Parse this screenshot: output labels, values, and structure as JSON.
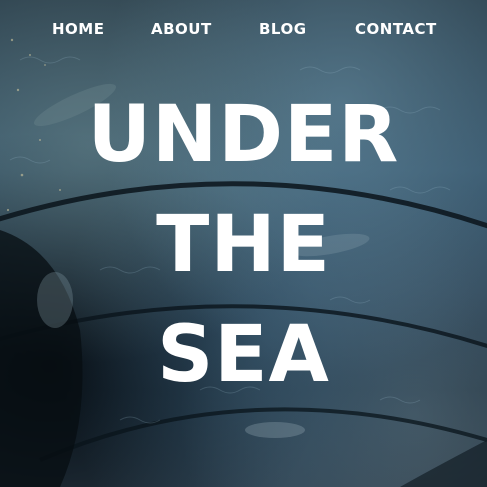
{
  "nav": {
    "items": [
      {
        "label": "HOME"
      },
      {
        "label": "ABOUT"
      },
      {
        "label": "BLOG"
      },
      {
        "label": "CONTACT"
      }
    ]
  },
  "hero": {
    "title_lines": [
      "UNDER",
      "THE",
      "SEA"
    ],
    "text_color": "#ffffff"
  }
}
